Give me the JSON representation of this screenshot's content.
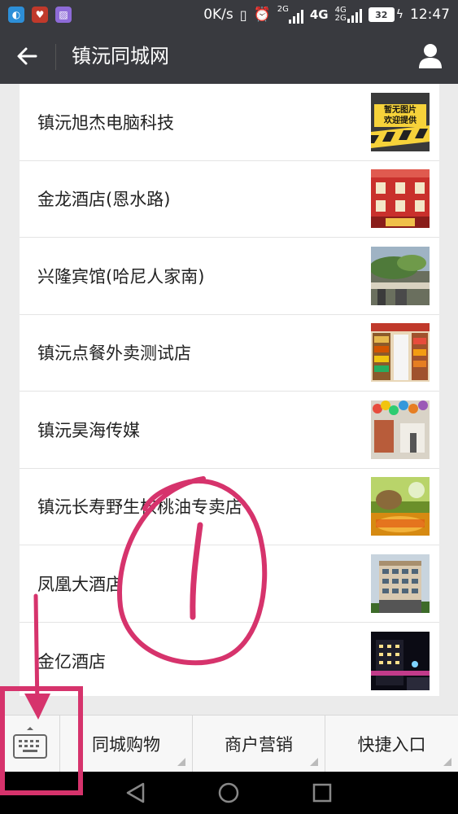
{
  "status_bar": {
    "speed": "0K/s",
    "net_2g": "2G",
    "net_4g": "4G",
    "net_4g2g_top": "4G",
    "net_4g2g_bottom": "2G",
    "battery": "32",
    "time": "12:47"
  },
  "nav": {
    "title": "镇沅同城网"
  },
  "list": [
    {
      "label": "镇沅旭杰电脑科技",
      "thumb_line1": "暂无图片",
      "thumb_line2": "欢迎提供"
    },
    {
      "label": "金龙酒店(恩水路)"
    },
    {
      "label": "兴隆宾馆(哈尼人家南)"
    },
    {
      "label": "镇沅点餐外卖测试店"
    },
    {
      "label": "镇沅昊海传媒"
    },
    {
      "label": "镇沅长寿野生核桃油专卖店"
    },
    {
      "label": "凤凰大酒店"
    },
    {
      "label": "金亿酒店"
    }
  ],
  "bottom_menu": {
    "items": [
      "同城购物",
      "商户营销",
      "快捷入口"
    ]
  },
  "colors": {
    "header": "#393a3f",
    "annotation": "#d6336c"
  }
}
